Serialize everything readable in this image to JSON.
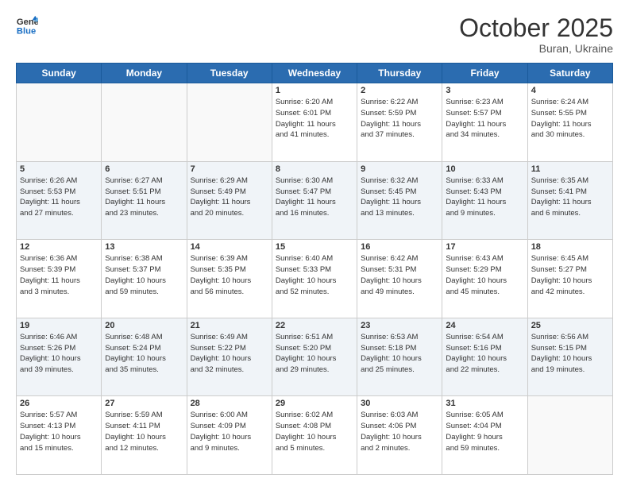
{
  "header": {
    "logo_line1": "General",
    "logo_line2": "Blue",
    "month": "October 2025",
    "location": "Buran, Ukraine"
  },
  "days_of_week": [
    "Sunday",
    "Monday",
    "Tuesday",
    "Wednesday",
    "Thursday",
    "Friday",
    "Saturday"
  ],
  "weeks": [
    [
      {
        "num": "",
        "info": ""
      },
      {
        "num": "",
        "info": ""
      },
      {
        "num": "",
        "info": ""
      },
      {
        "num": "1",
        "info": "Sunrise: 6:20 AM\nSunset: 6:01 PM\nDaylight: 11 hours\nand 41 minutes."
      },
      {
        "num": "2",
        "info": "Sunrise: 6:22 AM\nSunset: 5:59 PM\nDaylight: 11 hours\nand 37 minutes."
      },
      {
        "num": "3",
        "info": "Sunrise: 6:23 AM\nSunset: 5:57 PM\nDaylight: 11 hours\nand 34 minutes."
      },
      {
        "num": "4",
        "info": "Sunrise: 6:24 AM\nSunset: 5:55 PM\nDaylight: 11 hours\nand 30 minutes."
      }
    ],
    [
      {
        "num": "5",
        "info": "Sunrise: 6:26 AM\nSunset: 5:53 PM\nDaylight: 11 hours\nand 27 minutes."
      },
      {
        "num": "6",
        "info": "Sunrise: 6:27 AM\nSunset: 5:51 PM\nDaylight: 11 hours\nand 23 minutes."
      },
      {
        "num": "7",
        "info": "Sunrise: 6:29 AM\nSunset: 5:49 PM\nDaylight: 11 hours\nand 20 minutes."
      },
      {
        "num": "8",
        "info": "Sunrise: 6:30 AM\nSunset: 5:47 PM\nDaylight: 11 hours\nand 16 minutes."
      },
      {
        "num": "9",
        "info": "Sunrise: 6:32 AM\nSunset: 5:45 PM\nDaylight: 11 hours\nand 13 minutes."
      },
      {
        "num": "10",
        "info": "Sunrise: 6:33 AM\nSunset: 5:43 PM\nDaylight: 11 hours\nand 9 minutes."
      },
      {
        "num": "11",
        "info": "Sunrise: 6:35 AM\nSunset: 5:41 PM\nDaylight: 11 hours\nand 6 minutes."
      }
    ],
    [
      {
        "num": "12",
        "info": "Sunrise: 6:36 AM\nSunset: 5:39 PM\nDaylight: 11 hours\nand 3 minutes."
      },
      {
        "num": "13",
        "info": "Sunrise: 6:38 AM\nSunset: 5:37 PM\nDaylight: 10 hours\nand 59 minutes."
      },
      {
        "num": "14",
        "info": "Sunrise: 6:39 AM\nSunset: 5:35 PM\nDaylight: 10 hours\nand 56 minutes."
      },
      {
        "num": "15",
        "info": "Sunrise: 6:40 AM\nSunset: 5:33 PM\nDaylight: 10 hours\nand 52 minutes."
      },
      {
        "num": "16",
        "info": "Sunrise: 6:42 AM\nSunset: 5:31 PM\nDaylight: 10 hours\nand 49 minutes."
      },
      {
        "num": "17",
        "info": "Sunrise: 6:43 AM\nSunset: 5:29 PM\nDaylight: 10 hours\nand 45 minutes."
      },
      {
        "num": "18",
        "info": "Sunrise: 6:45 AM\nSunset: 5:27 PM\nDaylight: 10 hours\nand 42 minutes."
      }
    ],
    [
      {
        "num": "19",
        "info": "Sunrise: 6:46 AM\nSunset: 5:26 PM\nDaylight: 10 hours\nand 39 minutes."
      },
      {
        "num": "20",
        "info": "Sunrise: 6:48 AM\nSunset: 5:24 PM\nDaylight: 10 hours\nand 35 minutes."
      },
      {
        "num": "21",
        "info": "Sunrise: 6:49 AM\nSunset: 5:22 PM\nDaylight: 10 hours\nand 32 minutes."
      },
      {
        "num": "22",
        "info": "Sunrise: 6:51 AM\nSunset: 5:20 PM\nDaylight: 10 hours\nand 29 minutes."
      },
      {
        "num": "23",
        "info": "Sunrise: 6:53 AM\nSunset: 5:18 PM\nDaylight: 10 hours\nand 25 minutes."
      },
      {
        "num": "24",
        "info": "Sunrise: 6:54 AM\nSunset: 5:16 PM\nDaylight: 10 hours\nand 22 minutes."
      },
      {
        "num": "25",
        "info": "Sunrise: 6:56 AM\nSunset: 5:15 PM\nDaylight: 10 hours\nand 19 minutes."
      }
    ],
    [
      {
        "num": "26",
        "info": "Sunrise: 5:57 AM\nSunset: 4:13 PM\nDaylight: 10 hours\nand 15 minutes."
      },
      {
        "num": "27",
        "info": "Sunrise: 5:59 AM\nSunset: 4:11 PM\nDaylight: 10 hours\nand 12 minutes."
      },
      {
        "num": "28",
        "info": "Sunrise: 6:00 AM\nSunset: 4:09 PM\nDaylight: 10 hours\nand 9 minutes."
      },
      {
        "num": "29",
        "info": "Sunrise: 6:02 AM\nSunset: 4:08 PM\nDaylight: 10 hours\nand 5 minutes."
      },
      {
        "num": "30",
        "info": "Sunrise: 6:03 AM\nSunset: 4:06 PM\nDaylight: 10 hours\nand 2 minutes."
      },
      {
        "num": "31",
        "info": "Sunrise: 6:05 AM\nSunset: 4:04 PM\nDaylight: 9 hours\nand 59 minutes."
      },
      {
        "num": "",
        "info": ""
      }
    ]
  ]
}
